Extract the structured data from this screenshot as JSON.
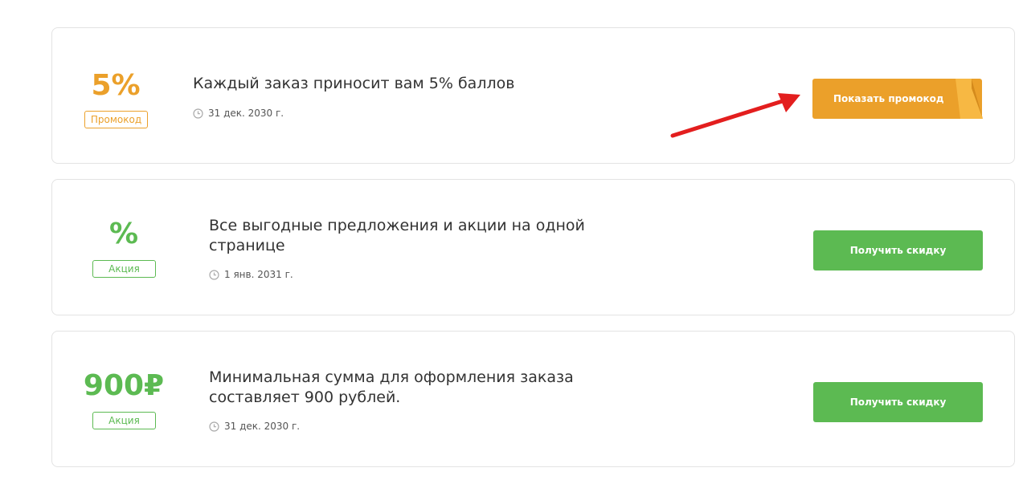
{
  "offers": [
    {
      "value": "5%",
      "badge": "Промокод",
      "title": "Каждый заказ приносит вам 5% баллов",
      "date": "31 дек. 2030 г.",
      "button": "Показать промокод"
    },
    {
      "value": "%",
      "badge": "Акция",
      "title": "Все выгодные предложения и акции на одной странице",
      "date": "1 янв. 2031 г.",
      "button": "Получить скидку"
    },
    {
      "value": "900₽",
      "badge": "Акция",
      "title": "Минимальная сумма для оформления заказа составляет 900 рублей.",
      "date": "31 дек. 2030 г.",
      "button": "Получить скидку"
    }
  ],
  "colors": {
    "promo_accent": "#eba02a",
    "deal_accent": "#5cba52",
    "arrow": "#e31e1e"
  },
  "icons": [
    "clock-icon",
    "arrow-annotation"
  ]
}
